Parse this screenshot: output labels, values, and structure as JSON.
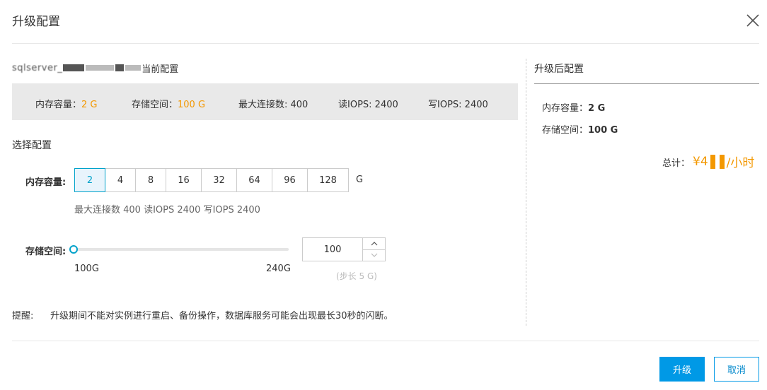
{
  "dialog": {
    "title": "升级配置"
  },
  "current": {
    "instance_name": "sqlserver_",
    "label": "当前配置",
    "memory_label": "内存容量：",
    "memory_value": "2 G",
    "storage_label": "存储空间：",
    "storage_value": "100 G",
    "max_conn": "最大连接数: 400",
    "read_iops": "读IOPS: 2400",
    "write_iops": "写IOPS: 2400"
  },
  "select": {
    "title": "选择配置",
    "memory_label": "内存容量:",
    "memory_options": [
      "2",
      "4",
      "8",
      "16",
      "32",
      "64",
      "96",
      "128"
    ],
    "memory_selected": "2",
    "memory_unit": "G",
    "memory_hint": "最大连接数 400 读IOPS 2400 写IOPS 2400",
    "storage_label": "存储空间:",
    "slider_min": "100G",
    "slider_max": "240G",
    "slider_position": 0,
    "storage_value": "100",
    "step_hint": "(步长 5 G)"
  },
  "tip": {
    "label": "提醒:",
    "text": "升级期间不能对实例进行重启、备份操作，数据库服务可能会出现最长30秒的闪断。"
  },
  "after": {
    "title": "升级后配置",
    "memory_label": "内存容量：",
    "memory_value": "2 G",
    "storage_label": "存储空间：",
    "storage_value": "100 G",
    "total_label": "总计：",
    "price_prefix": "¥4",
    "price_suffix": "/小时"
  },
  "footer": {
    "upgrade_label": "升级",
    "cancel_label": "取消"
  },
  "colors": {
    "accent": "#0099e6",
    "price": "#f39800",
    "selected_border": "#00a2ca"
  }
}
